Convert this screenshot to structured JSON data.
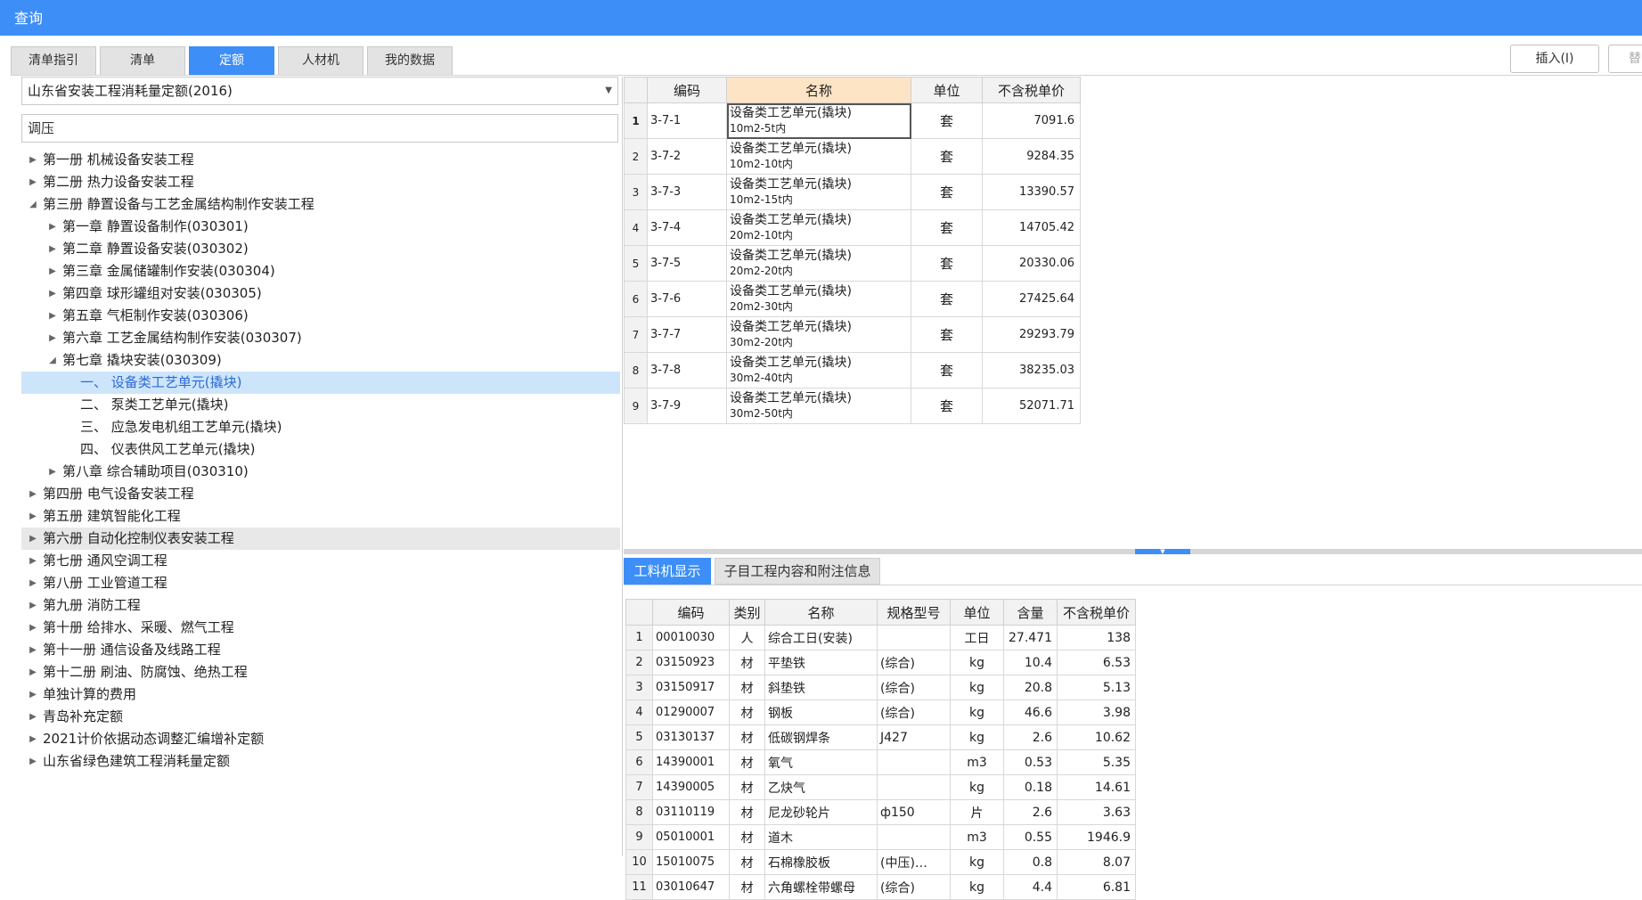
{
  "window": {
    "title": "查询"
  },
  "tabs": [
    "清单指引",
    "清单",
    "定额",
    "人材机",
    "我的数据"
  ],
  "active_tab": 2,
  "buttons": {
    "insert": "插入(I)",
    "replace_partial": "替"
  },
  "left": {
    "library": "山东省安装工程消耗量定额(2016)",
    "search_value": "调压",
    "tree": [
      {
        "label": "第一册 机械设备安装工程",
        "level": 0,
        "toggle": "collapsed"
      },
      {
        "label": "第二册 热力设备安装工程",
        "level": 0,
        "toggle": "collapsed"
      },
      {
        "label": "第三册 静置设备与工艺金属结构制作安装工程",
        "level": 0,
        "toggle": "expanded"
      },
      {
        "label": "第一章 静置设备制作(030301)",
        "level": 1,
        "toggle": "collapsed"
      },
      {
        "label": "第二章 静置设备安装(030302)",
        "level": 1,
        "toggle": "collapsed"
      },
      {
        "label": "第三章 金属储罐制作安装(030304)",
        "level": 1,
        "toggle": "collapsed"
      },
      {
        "label": "第四章 球形罐组对安装(030305)",
        "level": 1,
        "toggle": "collapsed"
      },
      {
        "label": "第五章 气柜制作安装(030306)",
        "level": 1,
        "toggle": "collapsed"
      },
      {
        "label": "第六章 工艺金属结构制作安装(030307)",
        "level": 1,
        "toggle": "collapsed"
      },
      {
        "label": "第七章 撬块安装(030309)",
        "level": 1,
        "toggle": "expanded"
      },
      {
        "label": "一、  设备类工艺单元(撬块)",
        "level": 2,
        "toggle": "none",
        "selected": true
      },
      {
        "label": "二、  泵类工艺单元(撬块)",
        "level": 2,
        "toggle": "none"
      },
      {
        "label": "三、  应急发电机组工艺单元(撬块)",
        "level": 2,
        "toggle": "none"
      },
      {
        "label": "四、  仪表供风工艺单元(撬块)",
        "level": 2,
        "toggle": "none"
      },
      {
        "label": "第八章 综合辅助项目(030310)",
        "level": 1,
        "toggle": "collapsed"
      },
      {
        "label": "第四册 电气设备安装工程",
        "level": 0,
        "toggle": "collapsed"
      },
      {
        "label": "第五册 建筑智能化工程",
        "level": 0,
        "toggle": "collapsed"
      },
      {
        "label": "第六册 自动化控制仪表安装工程",
        "level": 0,
        "toggle": "collapsed",
        "hover": true
      },
      {
        "label": "第七册 通风空调工程",
        "level": 0,
        "toggle": "collapsed"
      },
      {
        "label": "第八册 工业管道工程",
        "level": 0,
        "toggle": "collapsed"
      },
      {
        "label": "第九册 消防工程",
        "level": 0,
        "toggle": "collapsed"
      },
      {
        "label": "第十册 给排水、采暖、燃气工程",
        "level": 0,
        "toggle": "collapsed"
      },
      {
        "label": "第十一册 通信设备及线路工程",
        "level": 0,
        "toggle": "collapsed"
      },
      {
        "label": "第十二册 刷油、防腐蚀、绝热工程",
        "level": 0,
        "toggle": "collapsed"
      },
      {
        "label": "单独计算的费用",
        "level": 0,
        "toggle": "collapsed"
      },
      {
        "label": "青岛补充定额",
        "level": 0,
        "toggle": "collapsed"
      },
      {
        "label": "2021计价依据动态调整汇编增补定额",
        "level": 0,
        "toggle": "collapsed"
      },
      {
        "label": "山东省绿色建筑工程消耗量定额",
        "level": 0,
        "toggle": "collapsed"
      }
    ]
  },
  "quota_table": {
    "headers": [
      "",
      "编码",
      "名称",
      "单位",
      "不含税单价"
    ],
    "rows": [
      {
        "no": "1",
        "code": "3-7-1",
        "name": "设备类工艺单元(撬块)",
        "spec": "10m2-5t内",
        "unit": "套",
        "price": "7091.6"
      },
      {
        "no": "2",
        "code": "3-7-2",
        "name": "设备类工艺单元(撬块)",
        "spec": "10m2-10t内",
        "unit": "套",
        "price": "9284.35"
      },
      {
        "no": "3",
        "code": "3-7-3",
        "name": "设备类工艺单元(撬块)",
        "spec": "10m2-15t内",
        "unit": "套",
        "price": "13390.57"
      },
      {
        "no": "4",
        "code": "3-7-4",
        "name": "设备类工艺单元(撬块)",
        "spec": "20m2-10t内",
        "unit": "套",
        "price": "14705.42"
      },
      {
        "no": "5",
        "code": "3-7-5",
        "name": "设备类工艺单元(撬块)",
        "spec": "20m2-20t内",
        "unit": "套",
        "price": "20330.06"
      },
      {
        "no": "6",
        "code": "3-7-6",
        "name": "设备类工艺单元(撬块)",
        "spec": "20m2-30t内",
        "unit": "套",
        "price": "27425.64"
      },
      {
        "no": "7",
        "code": "3-7-7",
        "name": "设备类工艺单元(撬块)",
        "spec": "30m2-20t内",
        "unit": "套",
        "price": "29293.79"
      },
      {
        "no": "8",
        "code": "3-7-8",
        "name": "设备类工艺单元(撬块)",
        "spec": "30m2-40t内",
        "unit": "套",
        "price": "38235.03"
      },
      {
        "no": "9",
        "code": "3-7-9",
        "name": "设备类工艺单元(撬块)",
        "spec": "30m2-50t内",
        "unit": "套",
        "price": "52071.71"
      }
    ]
  },
  "detail_tabs": [
    "工料机显示",
    "子目工程内容和附注信息"
  ],
  "detail_table": {
    "headers": [
      "",
      "编码",
      "类别",
      "名称",
      "规格型号",
      "单位",
      "含量",
      "不含税单价"
    ],
    "rows": [
      {
        "no": "1",
        "code": "00010030",
        "type": "人",
        "name": "综合工日(安装)",
        "spec": "",
        "unit": "工日",
        "qty": "27.471",
        "price": "138"
      },
      {
        "no": "2",
        "code": "03150923",
        "type": "材",
        "name": "平垫铁",
        "spec": "(综合)",
        "unit": "kg",
        "qty": "10.4",
        "price": "6.53"
      },
      {
        "no": "3",
        "code": "03150917",
        "type": "材",
        "name": "斜垫铁",
        "spec": "(综合)",
        "unit": "kg",
        "qty": "20.8",
        "price": "5.13"
      },
      {
        "no": "4",
        "code": "01290007",
        "type": "材",
        "name": "钢板",
        "spec": "(综合)",
        "unit": "kg",
        "qty": "46.6",
        "price": "3.98"
      },
      {
        "no": "5",
        "code": "03130137",
        "type": "材",
        "name": "低碳钢焊条",
        "spec": "J427",
        "unit": "kg",
        "qty": "2.6",
        "price": "10.62"
      },
      {
        "no": "6",
        "code": "14390001",
        "type": "材",
        "name": "氧气",
        "spec": "",
        "unit": "m3",
        "qty": "0.53",
        "price": "5.35"
      },
      {
        "no": "7",
        "code": "14390005",
        "type": "材",
        "name": "乙炔气",
        "spec": "",
        "unit": "kg",
        "qty": "0.18",
        "price": "14.61"
      },
      {
        "no": "8",
        "code": "03110119",
        "type": "材",
        "name": "尼龙砂轮片",
        "spec": "ф150",
        "unit": "片",
        "qty": "2.6",
        "price": "3.63"
      },
      {
        "no": "9",
        "code": "05010001",
        "type": "材",
        "name": "道木",
        "spec": "",
        "unit": "m3",
        "qty": "0.55",
        "price": "1946.9"
      },
      {
        "no": "10",
        "code": "15010075",
        "type": "材",
        "name": "石棉橡胶板",
        "spec": "(中压)…",
        "unit": "kg",
        "qty": "0.8",
        "price": "8.07"
      },
      {
        "no": "11",
        "code": "03010647",
        "type": "材",
        "name": "六角螺栓带螺母",
        "spec": "(综合)",
        "unit": "kg",
        "qty": "4.4",
        "price": "6.81"
      }
    ]
  },
  "colors": {
    "accent": "#3d8ef6",
    "selected_row": "#cde5fb",
    "header_highlight": "#fde4c4"
  }
}
